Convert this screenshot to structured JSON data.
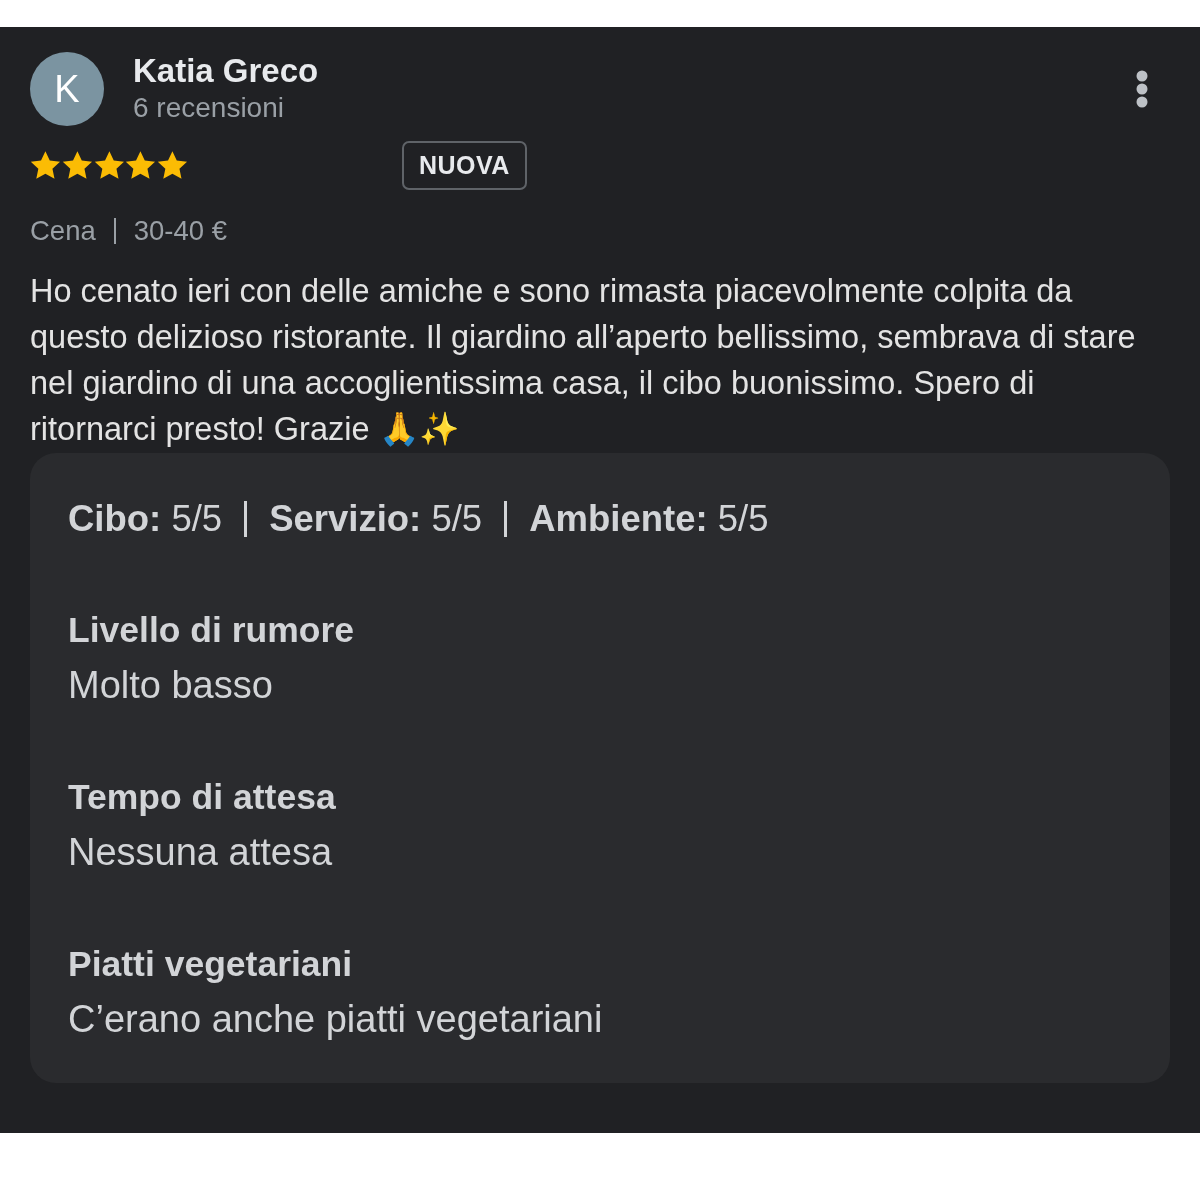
{
  "reviewer": {
    "avatar_letter": "K",
    "name": "Katia Greco",
    "review_count": "6 recensioni"
  },
  "review": {
    "stars": 5,
    "badge": "NUOVA",
    "meta": [
      "Cena",
      "30-40 €"
    ],
    "text": "Ho cenato ieri con delle amiche e sono rimasta piacevolmente colpita da questo delizioso ristorante. Il giardino all’aperto bellissimo, sembrava di stare nel giardino di una accoglientissima casa, il cibo buonissimo. Spero di ritornarci presto! Grazie 🙏✨"
  },
  "details": {
    "ratings": [
      "**Cibo:** 5/5",
      "**Servizio:** 5/5",
      "**Ambiente:** 5/5"
    ],
    "attributes": [
      {
        "label": "Livello di rumore",
        "value": "Molto basso"
      },
      {
        "label": "Tempo di attesa",
        "value": "Nessuna attesa"
      },
      {
        "label": "Piatti vegetariani",
        "value": "C’erano anche piatti vegetariani"
      }
    ]
  }
}
